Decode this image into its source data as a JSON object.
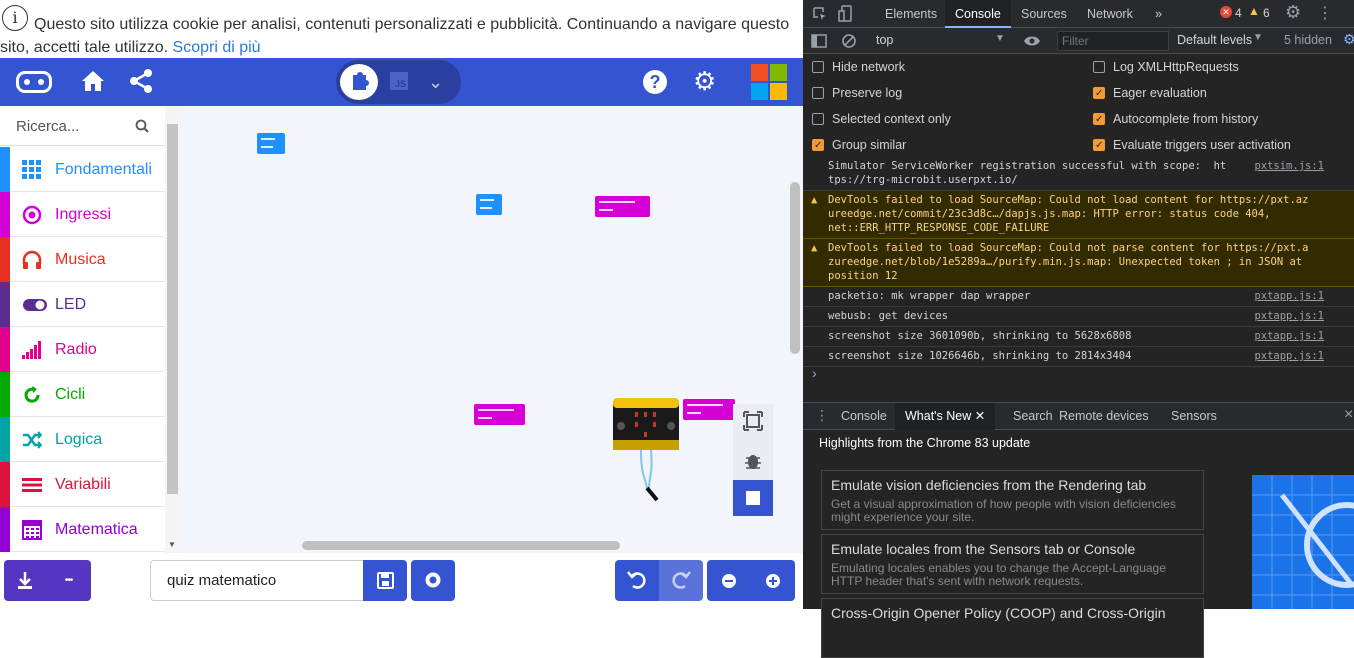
{
  "cookie": {
    "info_icon": "i",
    "line1": "Questo sito utilizza cookie per analisi, contenuti personalizzati e pubblicità. Continuando a navigare questo",
    "line2": "sito, accetti tale utilizzo.",
    "link": "Scopri di più"
  },
  "menubar": {
    "color": "#3454d1",
    "toggle_js": "JS",
    "help": "?",
    "icons": [
      "microbit-logo-icon",
      "home-icon",
      "share-icon",
      "puzzle-icon",
      "javascript-icon",
      "chevron-down-icon",
      "help-icon",
      "gear-icon",
      "microsoft-logo-icon"
    ]
  },
  "toolbox": {
    "search_placeholder": "Ricerca...",
    "categories": [
      {
        "label": "Fondamentali",
        "color": "#1e90ff",
        "icon": "grid-icon"
      },
      {
        "label": "Ingressi",
        "color": "#d400d4",
        "icon": "target-icon"
      },
      {
        "label": "Musica",
        "color": "#e63022",
        "icon": "headphones-icon"
      },
      {
        "label": "LED",
        "color": "#5c2d91",
        "icon": "toggle-icon"
      },
      {
        "label": "Radio",
        "color": "#e3008c",
        "icon": "signal-bars-icon"
      },
      {
        "label": "Cicli",
        "color": "#00aa00",
        "icon": "refresh-icon"
      },
      {
        "label": "Logica",
        "color": "#00a4a6",
        "icon": "shuffle-icon"
      },
      {
        "label": "Variabili",
        "color": "#dc143c",
        "icon": "list-icon"
      },
      {
        "label": "Matematica",
        "color": "#9400d3",
        "icon": "calculator-icon"
      }
    ]
  },
  "bottom": {
    "project_name": "quiz matematico",
    "more": "•••"
  },
  "devtools": {
    "tabs": [
      "Elements",
      "Console",
      "Sources",
      "Network",
      "»"
    ],
    "active_tab": "Console",
    "errors": "4",
    "warnings": "6",
    "context": "top",
    "filter_placeholder": "Filter",
    "levels": "Default levels",
    "hidden": "5 hidden",
    "options_left": [
      {
        "label": "Hide network",
        "checked": false
      },
      {
        "label": "Preserve log",
        "checked": false
      },
      {
        "label": "Selected context only",
        "checked": false
      },
      {
        "label": "Group similar",
        "checked": true
      }
    ],
    "options_right": [
      {
        "label": "Log XMLHttpRequests",
        "checked": false
      },
      {
        "label": "Eager evaluation",
        "checked": true
      },
      {
        "label": "Autocomplete from history",
        "checked": true
      },
      {
        "label": "Evaluate triggers user activation",
        "checked": true
      }
    ],
    "logs": [
      {
        "text": "Simulator ServiceWorker registration successful with scope:  ht\ntps://trg-microbit.userpxt.io/",
        "src": "pxtsim.js:1",
        "warn": false
      },
      {
        "text": "DevTools failed to load SourceMap: Could not load content for https://pxt.az\nureedge.net/commit/23c3d8c…/dapjs.js.map: HTTP error: status code 404,\nnet::ERR_HTTP_RESPONSE_CODE_FAILURE",
        "src": "",
        "warn": true
      },
      {
        "text": "DevTools failed to load SourceMap: Could not parse content for https://pxt.a\nzureedge.net/blob/1e5289a…/purify.min.js.map: Unexpected token ; in JSON at\nposition 12",
        "src": "",
        "warn": true
      },
      {
        "text": "packetio: mk wrapper dap wrapper",
        "src": "pxtapp.js:1",
        "warn": false
      },
      {
        "text": "webusb: get devices",
        "src": "pxtapp.js:1",
        "warn": false
      },
      {
        "text": "screenshot size 3601090b, shrinking to 5628x6808",
        "src": "pxtapp.js:1",
        "warn": false
      },
      {
        "text": "screenshot size 1026646b, shrinking to 2814x3404",
        "src": "pxtapp.js:1",
        "warn": false
      }
    ],
    "prompt": "›",
    "drawer_tabs": [
      "Console",
      "What's New",
      "Search",
      "Remote devices",
      "Sensors"
    ],
    "drawer_active": "What's New",
    "close": "×",
    "highlights": "Highlights from the Chrome 83 update",
    "cards": [
      {
        "title": "Emulate vision deficiencies from the Rendering tab",
        "desc": "Get a visual approximation of how people with vision deficiencies might experience your site."
      },
      {
        "title": "Emulate locales from the Sensors tab or Console",
        "desc": "Emulating locales enables you to change the Accept-Language HTTP header that's sent with network requests."
      },
      {
        "title": "Cross-Origin Opener Policy (COOP) and Cross-Origin",
        "desc": ""
      }
    ]
  }
}
